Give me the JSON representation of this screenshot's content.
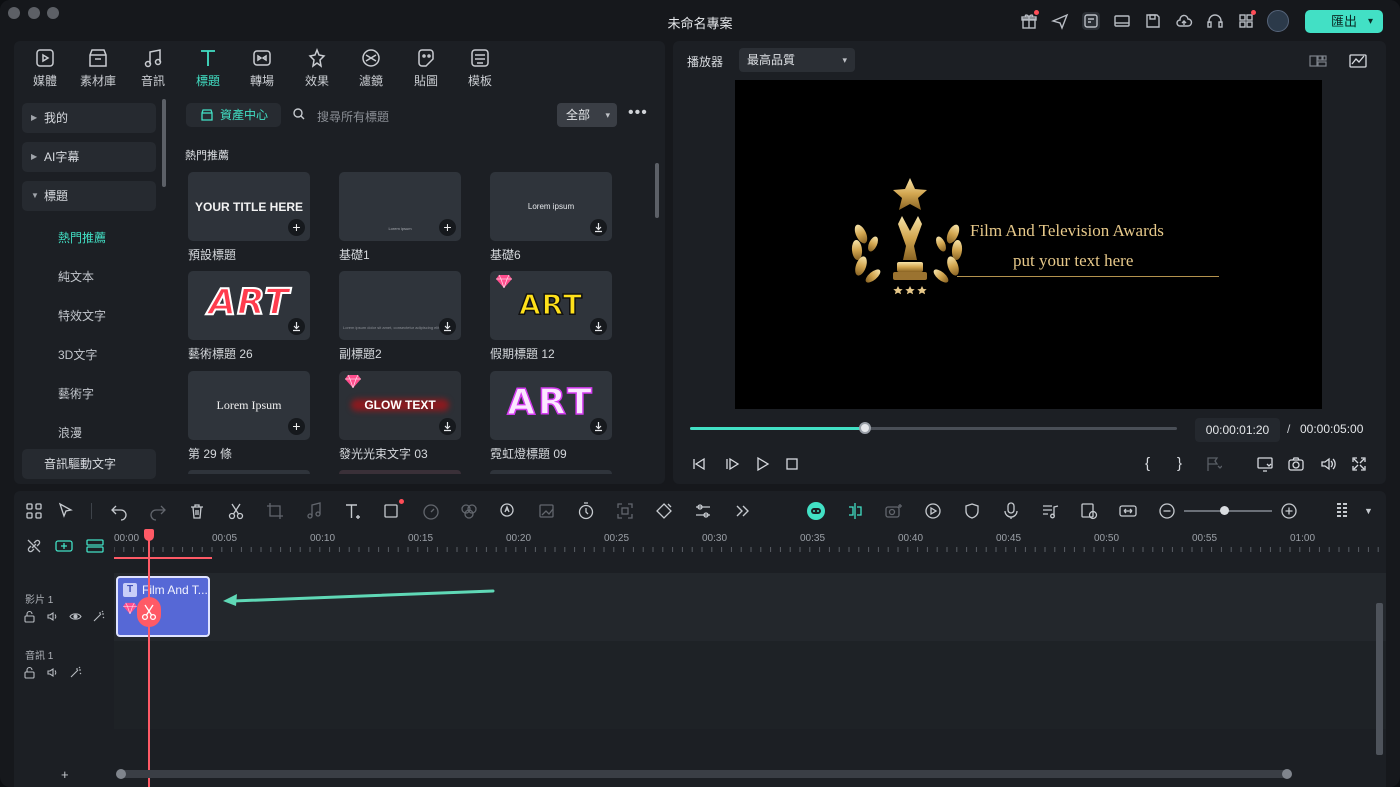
{
  "window": {
    "title": "未命名專案",
    "export_label": "匯出",
    "export_chevron": "▾"
  },
  "tool_tabs": [
    {
      "label": "媒體",
      "icon": "media-icon"
    },
    {
      "label": "素材庫",
      "icon": "stock-icon"
    },
    {
      "label": "音訊",
      "icon": "music-icon"
    },
    {
      "label": "標題",
      "icon": "title-icon",
      "active": true
    },
    {
      "label": "轉場",
      "icon": "transition-icon"
    },
    {
      "label": "效果",
      "icon": "effects-icon"
    },
    {
      "label": "濾鏡",
      "icon": "filter-icon"
    },
    {
      "label": "貼圖",
      "icon": "sticker-icon"
    },
    {
      "label": "模板",
      "icon": "template-icon"
    }
  ],
  "sidebar": {
    "groups": [
      {
        "label": "我的"
      },
      {
        "label": "AI字幕"
      },
      {
        "label": "標題",
        "expanded": true
      }
    ],
    "sub_items": [
      "熱門推薦",
      "純文本",
      "特效文字",
      "3D文字",
      "藝術字",
      "浪漫"
    ],
    "last_group": "音訊驅動文字"
  },
  "content": {
    "asset_center": "資產中心",
    "search_placeholder": "搜尋所有標題",
    "filter_value": "全部",
    "filter_chevron": "▾",
    "more_glyph": "•••",
    "section_title": "熱門推薦",
    "cards": [
      {
        "label": "預設標題",
        "thumb_text": "YOUR TITLE HERE",
        "action": "add"
      },
      {
        "label": "基礎1",
        "thumb_text": "Lorem ipsum",
        "action": "add"
      },
      {
        "label": "基礎6",
        "thumb_text": "Lorem ipsum",
        "action": "download"
      },
      {
        "label": "藝術標題 26",
        "thumb_text": "ART",
        "action": "download"
      },
      {
        "label": "副標題2",
        "thumb_text": "Lorem ipsum dolor sit amet, consectetur adipiscing elit",
        "action": "download"
      },
      {
        "label": "假期標題 12",
        "thumb_text": "ART",
        "action": "download",
        "premium": true
      },
      {
        "label": "第 29 條",
        "thumb_text": "Lorem Ipsum",
        "action": "add"
      },
      {
        "label": "發光光束文字 03",
        "thumb_text": "GLOW TEXT",
        "action": "download",
        "premium": true
      },
      {
        "label": "霓虹燈標題 09",
        "thumb_text": "ART",
        "action": "download"
      }
    ]
  },
  "player": {
    "label": "播放器",
    "quality": "最高品質",
    "quality_chevron": "▾",
    "preview_title": "Film And Television Awards",
    "preview_subtitle": "put your text here",
    "current_time": "00:00:01:20",
    "separator": "/",
    "total_time": "00:00:05:00",
    "progress_fraction": 0.36,
    "bracket_in": "{",
    "bracket_out": "}"
  },
  "timeline": {
    "ticks": [
      "00:00",
      "00:05",
      "00:10",
      "00:15",
      "00:20",
      "00:25",
      "00:30",
      "00:35",
      "00:40",
      "00:45",
      "00:50",
      "00:55",
      "01:00"
    ],
    "tracks": [
      {
        "name": "影片 1"
      },
      {
        "name": "音訊 1"
      }
    ],
    "clip_title": "Film And T...",
    "clip_icon_letter": "T",
    "add_track": "+"
  },
  "colors": {
    "accent": "#42e0c5",
    "playhead": "#ff5a66",
    "clip": "#5668d6",
    "gold": "#e7c98a"
  }
}
